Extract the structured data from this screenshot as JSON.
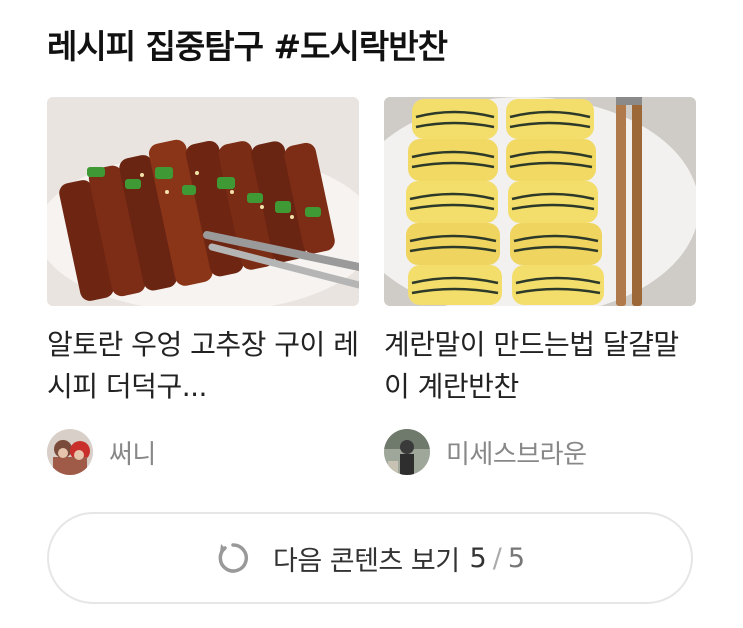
{
  "section": {
    "title": "레시피 집중탐구 #도시락반찬"
  },
  "cards": [
    {
      "title": "알토란 우엉 고추장 구이 레시피 더덕구...",
      "author": "써니",
      "image_icon": "grilled-burdock-photo"
    },
    {
      "title": "계란말이 만드는법 달걀말이 계란반찬",
      "author": "미세스브라운",
      "image_icon": "egg-roll-photo"
    }
  ],
  "more": {
    "label": "다음 콘텐츠 보기",
    "current_page": "5",
    "separator": "/",
    "total_pages": "5",
    "icon": "refresh-icon"
  },
  "colors": {
    "title": "#111111",
    "card_title": "#222222",
    "author": "#888888",
    "button_border": "#e6e6e6",
    "icon": "#999999"
  }
}
